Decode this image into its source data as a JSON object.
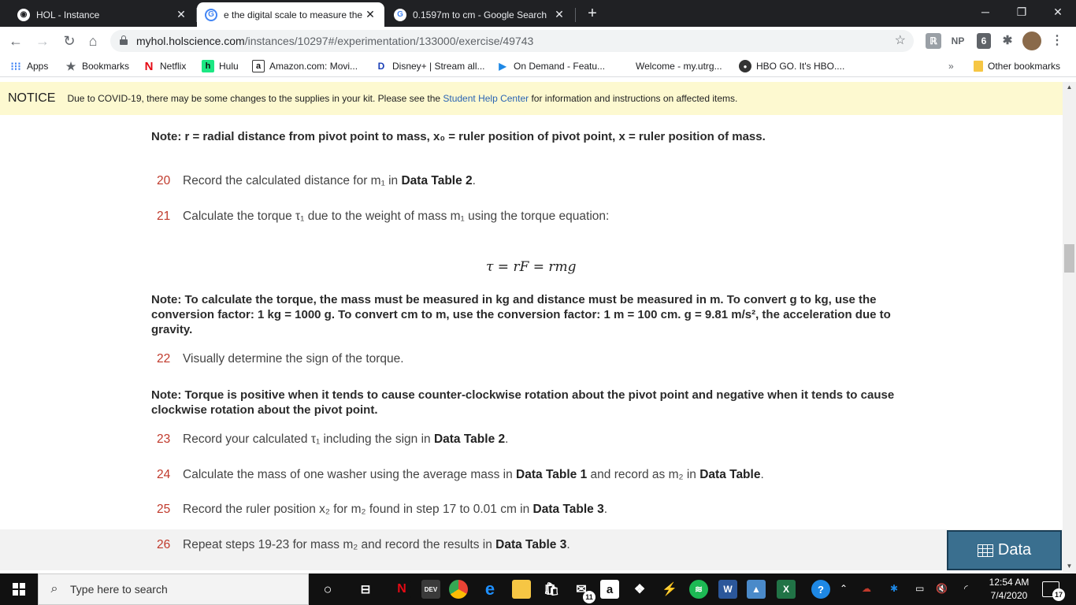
{
  "tabs": [
    {
      "title": "HOL - Instance",
      "favicon": "hol-favicon"
    },
    {
      "title": "e the digital scale to measure the",
      "favicon": "google-favicon"
    },
    {
      "title": "0.1597m to cm - Google Search",
      "favicon": "google-favicon"
    }
  ],
  "toolbar": {
    "url_host": "myhol.holscience.com",
    "url_path": "/instances/10297#/experimentation/133000/exercise/49743",
    "ext_np": "NP"
  },
  "bookmarks": [
    {
      "label": "Apps",
      "icon": "apps-grid-icon"
    },
    {
      "label": "Bookmarks",
      "icon": "star-icon"
    },
    {
      "label": "Netflix",
      "icon": "netflix-icon"
    },
    {
      "label": "Hulu",
      "icon": "hulu-icon"
    },
    {
      "label": "Amazon.com: Movi...",
      "icon": "amazon-icon"
    },
    {
      "label": "Disney+ | Stream all...",
      "icon": "disney-icon"
    },
    {
      "label": "On Demand - Featu...",
      "icon": "play-icon"
    },
    {
      "label": "Welcome - my.utrg...",
      "icon": "utrgv-icon"
    },
    {
      "label": "HBO GO. It's HBO....",
      "icon": "hbo-icon"
    }
  ],
  "bookmarks_more": "»",
  "other_bookmarks": "Other bookmarks",
  "notice": {
    "label": "NOTICE",
    "text_before": "Due to COVID-19, there may be some changes to the supplies in your kit. Please see the ",
    "link": "Student Help Center",
    "text_after": " for information and instructions on affected items."
  },
  "content": {
    "note1": "Note: r = radial distance from pivot point to mass, x₀ = ruler position of pivot point, x = ruler position of mass.",
    "steps": [
      {
        "num": "20",
        "pre": "Record the calculated distance for m₁ in ",
        "bold": "Data Table 2",
        "post": "."
      },
      {
        "num": "21",
        "pre": "Calculate the torque τ₁ due to the weight of mass m₁ using the torque equation:",
        "bold": "",
        "post": ""
      },
      {
        "num": "22",
        "pre": "Visually determine the sign of the torque.",
        "bold": "",
        "post": ""
      },
      {
        "num": "23",
        "pre": "Record your calculated τ₁ including the sign in ",
        "bold": "Data Table 2",
        "post": "."
      },
      {
        "num": "24",
        "pre": "Calculate the mass of one washer using the average mass in ",
        "bold": "Data Table 1",
        "mid": " and record as m₂ in ",
        "bold2": "Data Table",
        "post": "."
      },
      {
        "num": "25",
        "pre": "Record the ruler position x₂ for m₂ found in step 17 to 0.01 cm in ",
        "bold": "Data Table 3",
        "post": "."
      },
      {
        "num": "26",
        "pre": "Repeat steps 19-23 for mass m₂ and record the results in ",
        "bold": "Data Table 3",
        "post": "."
      }
    ],
    "formula": "τ = rF = rmg",
    "note2": "Note: To calculate the torque, the mass must be measured in kg and distance must be measured in m. To convert g to kg, use the conversion factor: 1 kg = 1000 g. To convert cm to m, use the conversion factor: 1 m = 100 cm. g = 9.81 m/s², the acceleration due to gravity.",
    "note3": "Note: Torque is positive when it tends to cause counter-clockwise rotation about the pivot point and negative when it tends to cause clockwise rotation about the pivot point.",
    "data_button": "Data"
  },
  "taskbar": {
    "search_placeholder": "Type here to search",
    "time": "12:54 AM",
    "date": "7/4/2020",
    "notification_count": "17",
    "mail_badge": "11",
    "dev_label": "DEV"
  },
  "colors": {
    "accent_step_number": "#c0392b",
    "link": "#2a64b3",
    "notice_bg": "#fdf9d0",
    "data_button": "#3a6f8f"
  }
}
